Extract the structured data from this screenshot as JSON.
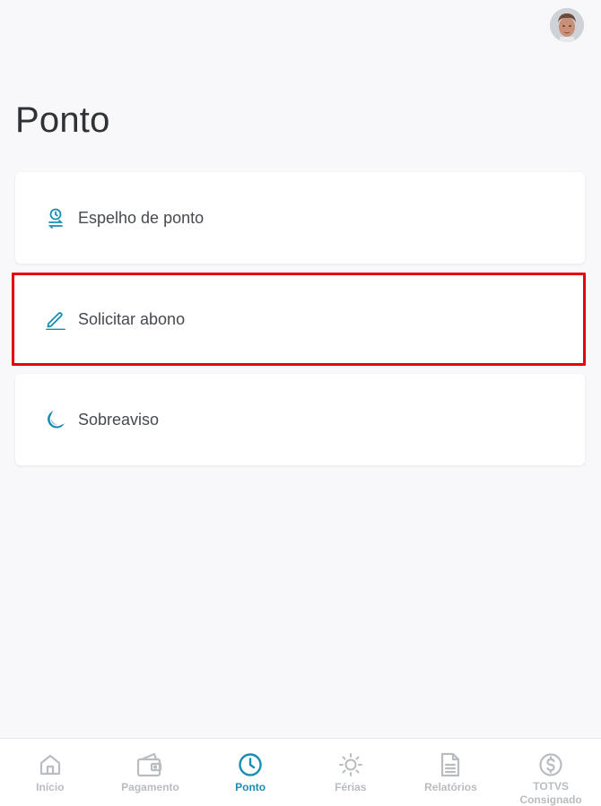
{
  "page": {
    "title": "Ponto"
  },
  "colors": {
    "accent": "#1a8db3",
    "inactive": "#b9bcc0",
    "highlight": "#e8000b"
  },
  "menu": [
    {
      "label": "Espelho de ponto",
      "icon": "clock-transfer-icon"
    },
    {
      "label": "Solicitar abono",
      "icon": "pencil-icon",
      "highlighted": true
    },
    {
      "label": "Sobreaviso",
      "icon": "moon-icon"
    }
  ],
  "bottom_nav": [
    {
      "label": "Início",
      "icon": "home-icon",
      "active": false
    },
    {
      "label": "Pagamento",
      "icon": "wallet-icon",
      "active": false
    },
    {
      "label": "Ponto",
      "icon": "clock-icon",
      "active": true
    },
    {
      "label": "Férias",
      "icon": "sun-icon",
      "active": false
    },
    {
      "label": "Relatórios",
      "icon": "document-icon",
      "active": false
    },
    {
      "label": "TOTVS Consignado",
      "icon": "dollar-coin-icon",
      "active": false
    }
  ]
}
